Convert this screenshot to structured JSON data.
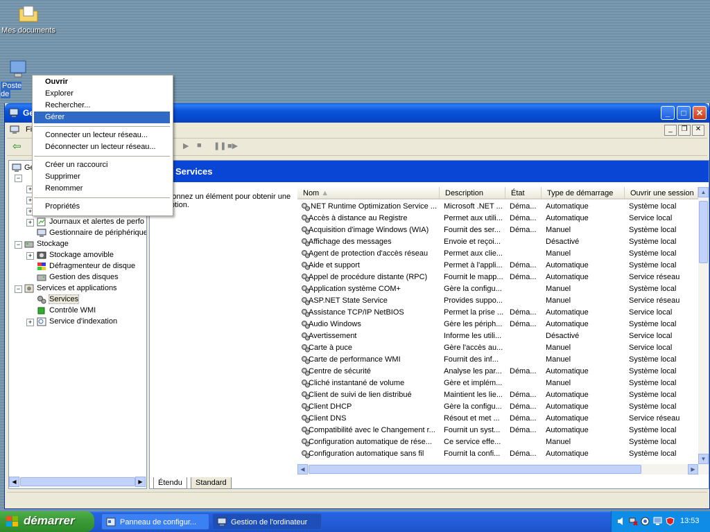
{
  "desktop": {
    "icons": [
      {
        "label": "Mes documents",
        "icon": "folder-documents-icon"
      },
      {
        "label": "Poste de",
        "icon": "my-computer-icon"
      }
    ]
  },
  "window": {
    "title": "Ge",
    "menu_first": "Fi"
  },
  "context_menu": {
    "items": [
      "Ouvrir",
      "Explorer",
      "Rechercher...",
      "Gérer",
      "Connecter un lecteur réseau...",
      "Déconnecter un lecteur réseau...",
      "Créer un raccourci",
      "Supprimer",
      "Renommer",
      "Propriétés"
    ],
    "highlighted": "Gérer"
  },
  "tree": {
    "root": "Ge",
    "items": [
      {
        "label": "Journaux et alertes de perfo",
        "icon": "log-icon"
      },
      {
        "label": "Gestionnaire de périphérique",
        "icon": "device-manager-icon"
      },
      {
        "label": "Stockage",
        "icon": "storage-icon"
      },
      {
        "label": "Stockage amovible",
        "icon": "removable-storage-icon"
      },
      {
        "label": "Défragmenteur de disque",
        "icon": "defrag-icon"
      },
      {
        "label": "Gestion des disques",
        "icon": "disk-icon"
      },
      {
        "label": "Services et applications",
        "icon": "services-apps-icon"
      },
      {
        "label": "Services",
        "icon": "services-icon"
      },
      {
        "label": "Contrôle WMI",
        "icon": "wmi-icon"
      },
      {
        "label": "Service d'indexation",
        "icon": "indexing-icon"
      }
    ]
  },
  "right_pane": {
    "banner": "Services",
    "description_partial": "ionnez un élément pour obtenir une ption."
  },
  "services_table": {
    "columns": [
      "Nom",
      "Description",
      "État",
      "Type de démarrage",
      "Ouvrir une session"
    ],
    "rows": [
      [
        ".NET Runtime Optimization Service ...",
        "Microsoft .NET ...",
        "Déma...",
        "Automatique",
        "Système local"
      ],
      [
        "Accès à distance au Registre",
        "Permet aux utili...",
        "Déma...",
        "Automatique",
        "Service local"
      ],
      [
        "Acquisition d'image Windows (WIA)",
        "Fournit des ser...",
        "Déma...",
        "Manuel",
        "Système local"
      ],
      [
        "Affichage des messages",
        "Envoie et reçoi...",
        "",
        "Désactivé",
        "Système local"
      ],
      [
        "Agent de protection d'accès réseau",
        "Permet aux clie...",
        "",
        "Manuel",
        "Système local"
      ],
      [
        "Aide et support",
        "Permet à l'appli...",
        "Déma...",
        "Automatique",
        "Système local"
      ],
      [
        "Appel de procédure distante (RPC)",
        "Fournit le mapp...",
        "Déma...",
        "Automatique",
        "Service réseau"
      ],
      [
        "Application système COM+",
        "Gère la configu...",
        "",
        "Manuel",
        "Système local"
      ],
      [
        "ASP.NET State Service",
        "Provides suppo...",
        "",
        "Manuel",
        "Service réseau"
      ],
      [
        "Assistance TCP/IP NetBIOS",
        "Permet la prise ...",
        "Déma...",
        "Automatique",
        "Service local"
      ],
      [
        "Audio Windows",
        "Gère les périph...",
        "Déma...",
        "Automatique",
        "Système local"
      ],
      [
        "Avertissement",
        "Informe les utili...",
        "",
        "Désactivé",
        "Service local"
      ],
      [
        "Carte à puce",
        "Gère l'accès au...",
        "",
        "Manuel",
        "Service local"
      ],
      [
        "Carte de performance WMI",
        "Fournit des inf...",
        "",
        "Manuel",
        "Système local"
      ],
      [
        "Centre de sécurité",
        "Analyse les par...",
        "Déma...",
        "Automatique",
        "Système local"
      ],
      [
        "Cliché instantané de volume",
        "Gère et implém...",
        "",
        "Manuel",
        "Système local"
      ],
      [
        "Client de suivi de lien distribué",
        "Maintient les lie...",
        "Déma...",
        "Automatique",
        "Système local"
      ],
      [
        "Client DHCP",
        "Gère la configu...",
        "Déma...",
        "Automatique",
        "Système local"
      ],
      [
        "Client DNS",
        "Résout et met ...",
        "Déma...",
        "Automatique",
        "Service réseau"
      ],
      [
        "Compatibilité avec le Changement r...",
        "Fournit un syst...",
        "Déma...",
        "Automatique",
        "Système local"
      ],
      [
        "Configuration automatique de rése...",
        "Ce service effe...",
        "",
        "Manuel",
        "Système local"
      ],
      [
        "Configuration automatique sans fil",
        "Fournit la confi...",
        "Déma...",
        "Automatique",
        "Système local"
      ]
    ]
  },
  "tabs": [
    "Étendu",
    "Standard"
  ],
  "taskbar": {
    "start_label": "démarrer",
    "tasks": [
      {
        "label": "Panneau de configur...",
        "active": false
      },
      {
        "label": "Gestion de l'ordinateur",
        "active": true
      }
    ],
    "clock": "13:53"
  }
}
